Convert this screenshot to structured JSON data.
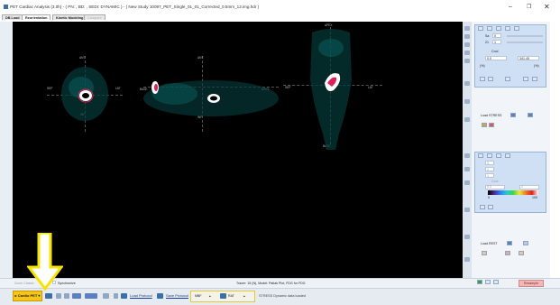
{
  "window": {
    "title": "PET Cardiac Analysis (3.0h) - ( PN: , BD: , SEDI: DYNAMIC ) - ( New Study 10097_PET_Single_01_01_Corrected_0.5mm_12.img.hdr )",
    "min_glyph": "–",
    "max_glyph": "❐",
    "close_glyph": "✕"
  },
  "tabs": [
    {
      "label": "DB Load",
      "state": "normal"
    },
    {
      "label": "Reorientation",
      "state": "active"
    },
    {
      "label": "Kinetic Modeling",
      "state": "normal"
    },
    {
      "label": "Compare",
      "state": "disabled"
    }
  ],
  "viewer": {
    "views": [
      {
        "top": "ANT",
        "bottom": "INF",
        "left": "SEP",
        "right": "LAT"
      },
      {
        "top": "ANT",
        "bottom": "INF",
        "left": "BASE",
        "right": "APEX"
      },
      {
        "top": "APEX",
        "bottom": "BASE",
        "left": "SEP",
        "right": "LAT"
      }
    ]
  },
  "right_panel": {
    "fields": {
      "field_a": "Sa",
      "field_a_val": "0",
      "field_b": "21",
      "field_b_val": "1",
      "field_b_pct": "1%",
      "colormap": "Cool",
      "range_lo": "0.0",
      "range_hi": "341.45",
      "pct_left": "(%)",
      "pct_right": "(%)",
      "stress_label": "Load STRESS",
      "rest_label": "Load REST",
      "field_c": "0",
      "field_d": "1",
      "field_e": "1",
      "colormap2": "Cool",
      "range2_lo": "0.0",
      "range2_hi": "2",
      "tick_lo": "0",
      "tick_hi": "100"
    }
  },
  "status_row": {
    "zoom_label": "Zoom Classic",
    "sync_label": "Synchronize",
    "tracer_text": "Tracer: 15 (N), Model: Patlak Plot, FDG for FDG"
  },
  "bottom": {
    "cardio_label": "▸ Cardio PET ▾",
    "load_protocol": "Load Protocol",
    "save_protocol": "Save Protocol",
    "rat_mode": "RAT",
    "model_field": "MBF",
    "status": "STRESS Dynamic data loaded",
    "deadline": "Resample"
  },
  "colors": {
    "accent_yellow": "#f5c518",
    "panel_bg": "#f1f4f8",
    "viewer_bg": "#000000"
  }
}
